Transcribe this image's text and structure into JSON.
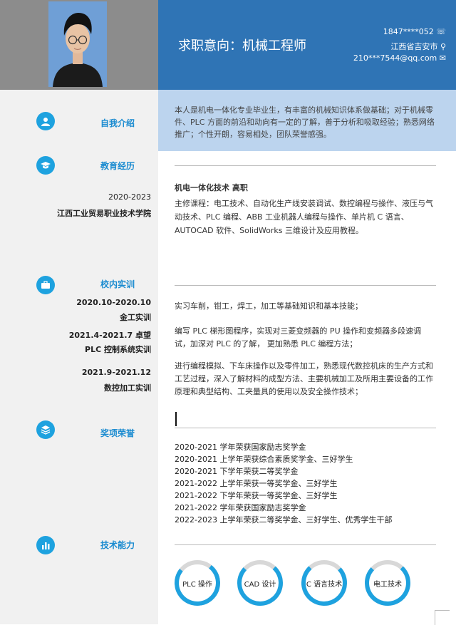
{
  "header": {
    "title": "求职意向：机械工程师",
    "phone": "1847****052",
    "address": "江西省吉安市",
    "email": "210***7544@qq.com"
  },
  "intro": {
    "heading": "自我介绍",
    "text": "本人是机电一体化专业毕业生，有丰富的机械知识体系做基础；对于机械零件、PLC 方面的前沿和动向有一定的了解，善于分析和吸取经验；熟悉网络推广；个性开朗，容易相处，团队荣誉感强。"
  },
  "education": {
    "heading": "教育经历",
    "years": "2020-2023",
    "school": "江西工业贸易职业技术学院",
    "major": "机电一体化技术 高职",
    "courses": "主修课程：电工技术、自动化生产线安装调试、数控编程与操作、液压与气动技术、PLC 编程、ABB 工业机器人编程与操作、单片机 C 语言、AUTOCAD 软件、SolidWorks 三维设计及应用教程。"
  },
  "training": {
    "heading": "校内实训",
    "items": [
      {
        "date": "2020.10-2020.10",
        "name": "金工实训",
        "desc": "实习车削，钳工，焊工，加工等基础知识和基本技能；"
      },
      {
        "date": "2021.4-2021.7 卓望",
        "name": "PLC 控制系统实训",
        "desc": "编写 PLC 梯形图程序，实现对三菱变频器的 PU 操作和变频器多段速调试，加深对 PLC 的了解， 更加熟悉 PLC 编程方法；"
      },
      {
        "date": "2021.9-2021.12",
        "name": "数控加工实训",
        "desc": "进行编程模拟、下车床操作以及零件加工，熟悉现代数控机床的生产方式和工艺过程，深入了解材料的成型方法、主要机械加工及所用主要设备的工作原理和典型结构、工夹量具的使用以及安全操作技术；"
      }
    ]
  },
  "awards": {
    "heading": "奖项荣誉",
    "items": [
      "2020-2021 学年荣获国家励志奖学金",
      "2020-2021 上学年荣获综合素质奖学金、三好学生",
      "2020-2021 下学年荣获二等奖学金",
      "2021-2022 上学年荣获一等奖学金、三好学生",
      "2021-2022 下学年荣获一等奖学金、三好学生",
      "2021-2022 学年荣获国家励志奖学金",
      "2022-2023 上学年荣获二等奖学金、三好学生、优秀学生干部"
    ]
  },
  "skills": {
    "heading": "技术能力",
    "items": [
      {
        "name": "PLC 操作",
        "level": 0.85
      },
      {
        "name": "CAD 设计",
        "level": 0.8
      },
      {
        "name": "C 语言技术",
        "level": 0.75
      },
      {
        "name": "电工技术",
        "level": 0.8
      }
    ]
  },
  "colors": {
    "accent": "#1ea2df",
    "header": "#2f74b5",
    "intro_bg": "#bcd4ee"
  }
}
